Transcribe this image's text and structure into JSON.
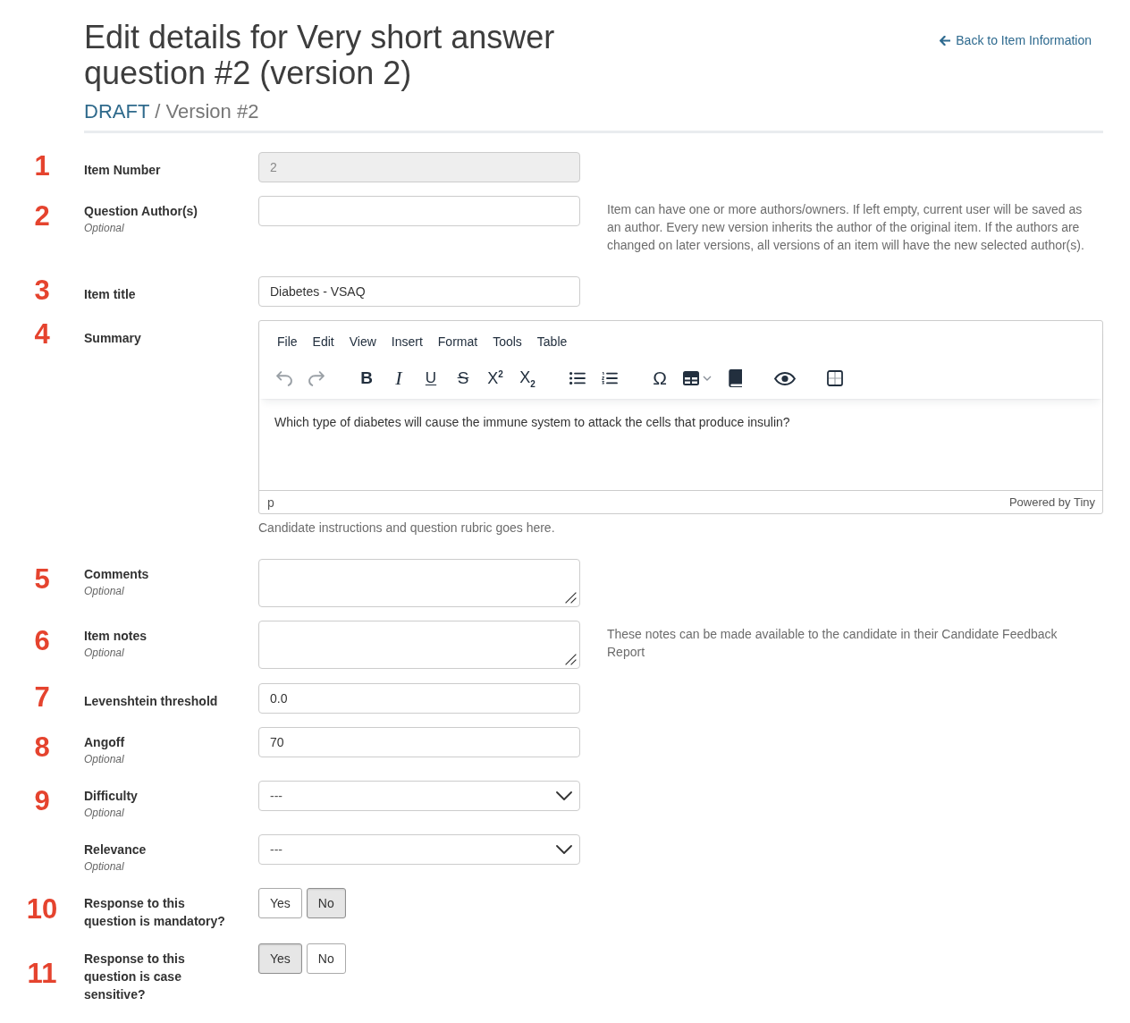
{
  "header": {
    "title": "Edit details for Very short answer question #2 (version 2)",
    "breadcrumb": "DRAFT",
    "separator": "/",
    "version": "Version #2",
    "back_link": "Back to Item Information"
  },
  "rows": [
    {
      "number": "1",
      "label": "Item Number",
      "kind": "text",
      "value": "2",
      "disabled": true
    },
    {
      "number": "2",
      "label": "Question Author(s)",
      "optional": "Optional",
      "kind": "text",
      "disabled": false,
      "help": "Item can have one or more authors/owners. If left empty, current user will be saved as an author. Every new version inherits the author of the original item. If the authors are changed on later versions, all versions of an item will have the new selected author(s)."
    },
    {
      "number": "3",
      "label": "Item title",
      "kind": "text",
      "value": "Diabetes - VSAQ",
      "disabled": false
    },
    {
      "number": "4",
      "label": "Summary",
      "kind": "editor",
      "editor": {
        "menu": [
          "File",
          "Edit",
          "View",
          "Insert",
          "Format",
          "Tools",
          "Table"
        ],
        "toolbar": [
          [
            {
              "kind": "undo",
              "disabled": true
            },
            {
              "kind": "redo",
              "disabled": true
            }
          ],
          [
            {
              "kind": "bold",
              "glyph": "B",
              "disabled": false
            },
            {
              "kind": "italic",
              "glyph": "I",
              "disabled": false
            },
            {
              "kind": "underline",
              "glyph": "U",
              "disabled": false
            },
            {
              "kind": "strikethrough",
              "glyph": "S",
              "disabled": false
            },
            {
              "kind": "superscript",
              "glyph": "X$^{2}$",
              "disabled": false
            },
            {
              "kind": "subscript",
              "glyph": "X$_{2}$",
              "disabled": false
            }
          ],
          [
            {
              "kind": "bullet_list",
              "disabled": false
            },
            {
              "kind": "numbered_list",
              "disabled": false
            }
          ],
          [
            {
              "kind": "special_character",
              "glyph": "Ω",
              "disabled": false
            },
            {
              "kind": "table",
              "disabled": false
            },
            {
              "kind": "book",
              "disabled": false
            }
          ],
          [
            {
              "kind": "preview",
              "disabled": false
            }
          ],
          [
            {
              "kind": "grid",
              "disabled": false
            }
          ]
        ],
        "content": "Which type of diabetes will cause the immune system to attack the cells that produce insulin?",
        "path": "p",
        "branding": "Powered by Tiny"
      },
      "hint": "Candidate instructions and question rubric goes here."
    },
    {
      "number": "5",
      "label": "Comments",
      "optional": "Optional",
      "kind": "textarea"
    },
    {
      "number": "6",
      "label": "Item notes",
      "optional": "Optional",
      "kind": "textarea",
      "help": "These notes can be made available to the candidate in their Candidate Feedback Report"
    },
    {
      "number": "7",
      "label": "Levenshtein threshold",
      "kind": "text",
      "value": "0.0",
      "disabled": false
    },
    {
      "number": "8",
      "label": "Angoff",
      "optional": "Optional",
      "kind": "text",
      "value": "70",
      "disabled": false
    },
    {
      "number": "9",
      "label": "Difficulty",
      "optional": "Optional",
      "kind": "select",
      "value": "---"
    },
    {
      "label": "Relevance",
      "optional": "Optional",
      "kind": "select",
      "value": "---"
    },
    {
      "number": "10",
      "label": "Response to this question is mandatory?",
      "kind": "toggle",
      "options": [
        {
          "label": "Yes",
          "selected": false
        },
        {
          "label": "No",
          "selected": true
        }
      ]
    },
    {
      "number": "11",
      "label": "Response to this question is case sensitive?",
      "kind": "toggle",
      "options": [
        {
          "label": "Yes",
          "selected": true
        },
        {
          "label": "No",
          "selected": false
        }
      ]
    }
  ]
}
